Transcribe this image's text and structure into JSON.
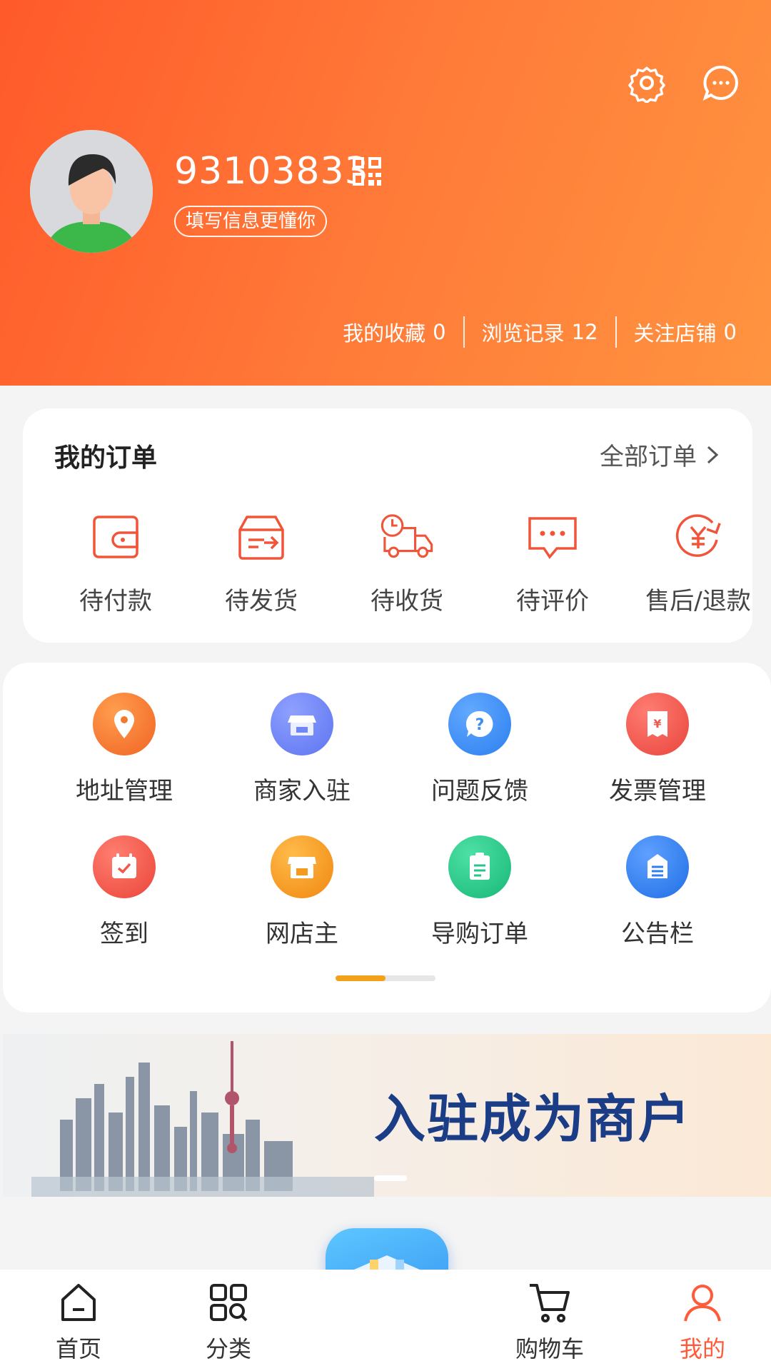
{
  "header": {
    "username": "93103833",
    "profile_tag": "填写信息更懂你",
    "stats": [
      {
        "label": "我的收藏",
        "value": "0"
      },
      {
        "label": "浏览记录",
        "value": "12"
      },
      {
        "label": "关注店铺",
        "value": "0"
      }
    ]
  },
  "orders": {
    "title": "我的订单",
    "all_label": "全部订单",
    "items": [
      {
        "label": "待付款",
        "icon": "wallet-icon"
      },
      {
        "label": "待发货",
        "icon": "box-ship-icon"
      },
      {
        "label": "待收货",
        "icon": "truck-icon"
      },
      {
        "label": "待评价",
        "icon": "comment-icon"
      },
      {
        "label": "售后/退款",
        "icon": "refund-icon"
      }
    ]
  },
  "services": {
    "items": [
      {
        "label": "地址管理",
        "icon": "location-pin-icon",
        "color": "#f47b2b"
      },
      {
        "label": "商家入驻",
        "icon": "shop-icon",
        "color": "#6f86f6"
      },
      {
        "label": "问题反馈",
        "icon": "question-icon",
        "color": "#3d8df2"
      },
      {
        "label": "发票管理",
        "icon": "invoice-icon",
        "color": "#ef5a4f"
      },
      {
        "label": "签到",
        "icon": "calendar-check-icon",
        "color": "#f2574a"
      },
      {
        "label": "网店主",
        "icon": "store-icon",
        "color": "#f59a1a"
      },
      {
        "label": "导购订单",
        "icon": "clipboard-icon",
        "color": "#26c68a"
      },
      {
        "label": "公告栏",
        "icon": "notice-icon",
        "color": "#2f7ff0"
      }
    ],
    "page_progress": 0.5
  },
  "banner": {
    "title": "入驻成为商户"
  },
  "bottom_nav": {
    "items": [
      {
        "label": "首页",
        "icon": "home-icon"
      },
      {
        "label": "分类",
        "icon": "category-icon"
      },
      {
        "label": "购物车",
        "icon": "cart-icon"
      },
      {
        "label": "我的",
        "icon": "user-icon",
        "active": true
      }
    ]
  },
  "colors": {
    "header_start": "#ff5a2a",
    "header_end": "#ff9440",
    "accent": "#ff5b3a",
    "order_icon": "#f0553a",
    "indicator": "#f2a11a"
  }
}
